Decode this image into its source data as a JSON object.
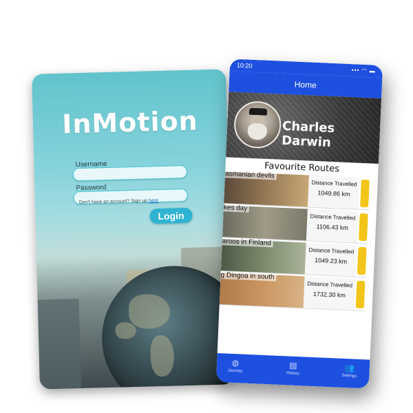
{
  "login_screen": {
    "brand": "InMotion",
    "username_label": "Username",
    "password_label": "Password",
    "signup_text": "Don't have an account? Sign up",
    "signup_link": "here",
    "login_button": "Login"
  },
  "app_screen": {
    "status_time": "10:20",
    "status_icons": "▪▪▪ ◠ ▬",
    "nav_title": "Home",
    "profile_name": "Charles Darwin",
    "section_title": "Favourite Routes",
    "routes": [
      {
        "name": "asmanian devils",
        "label": "Distance Travelled",
        "distance": "1049.86 km"
      },
      {
        "name": "kes day",
        "label": "Distance Travelled",
        "distance": "1106.43 km"
      },
      {
        "name": "aroos in Finland",
        "label": "Distance Travelled",
        "distance": "1049.23 km"
      },
      {
        "name": "g Dingoa in south",
        "label": "Distance Travelled",
        "distance": "1732.30 km"
      }
    ],
    "tabs": [
      {
        "label": "Journey",
        "icon": "journey-icon"
      },
      {
        "label": "History",
        "icon": "history-icon"
      },
      {
        "label": "Settings",
        "icon": "settings-icon"
      }
    ]
  },
  "colors": {
    "brand_blue": "#1e50e0",
    "accent_yellow": "#f3c51a",
    "login_cyan": "#2fb3d2"
  }
}
